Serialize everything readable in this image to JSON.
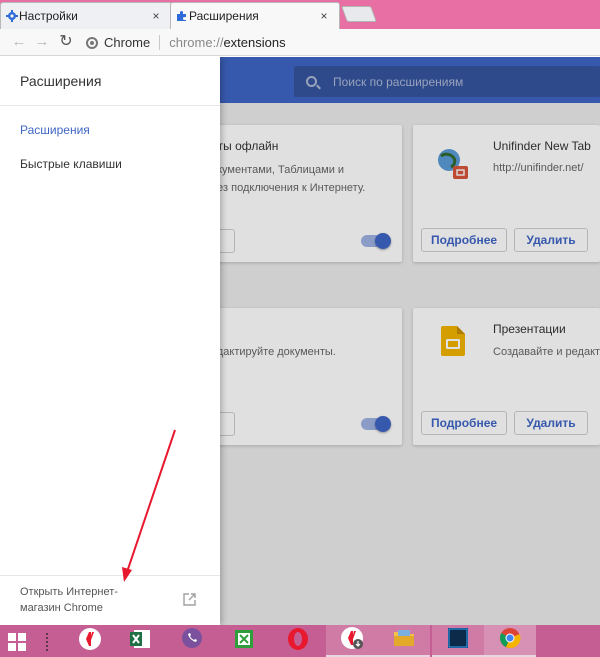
{
  "tabs": [
    {
      "title": "Настройки",
      "close": "×",
      "icon": "gear-icon"
    },
    {
      "title": "Расширения",
      "close": "×",
      "icon": "puzzle-icon"
    }
  ],
  "toolbar": {
    "back": "←",
    "forward": "→",
    "reload": "↻",
    "site_chip": "Chrome",
    "url_scheme": "chrome://",
    "url_host": "extensions"
  },
  "page": {
    "search_placeholder": "Поиск по расширениям",
    "brand_color": "#3f66c5"
  },
  "cards": [
    {
      "title": "нты офлайн",
      "desc_lines": [
        "окументами, Таблицами и",
        "без подключения к Интернету."
      ],
      "toggle_on": true
    },
    {
      "title": "Unifinder New Tab",
      "desc_lines": [
        "http://unifinder.net/"
      ],
      "details_label": "Подробнее",
      "remove_label": "Удалить",
      "icon": "globe-icon"
    },
    {
      "title": "",
      "desc_lines": [
        "едактируйте документы."
      ],
      "toggle_on": true
    },
    {
      "title": "Презентации",
      "desc_lines": [
        "Создавайте и редакт"
      ],
      "details_label": "Подробнее",
      "remove_label": "Удалить",
      "icon": "slides-icon"
    }
  ],
  "drawer": {
    "title": "Расширения",
    "items": [
      {
        "label": "Расширения",
        "selected": true
      },
      {
        "label": "Быстрые клавиши",
        "selected": false
      }
    ],
    "footer_lines": [
      "Открыть Интернет-",
      "магазин Chrome"
    ]
  },
  "taskbar": {
    "apps": [
      "yandex-browser",
      "excel",
      "viber",
      "excel-green",
      "opera",
      "yandex-download",
      "file-explorer",
      "photoshop",
      "chrome"
    ]
  },
  "colors": {
    "tab_strip": "#e86fa3",
    "taskbar": "#c55e93",
    "annotation_arrow": "#e8182e"
  }
}
